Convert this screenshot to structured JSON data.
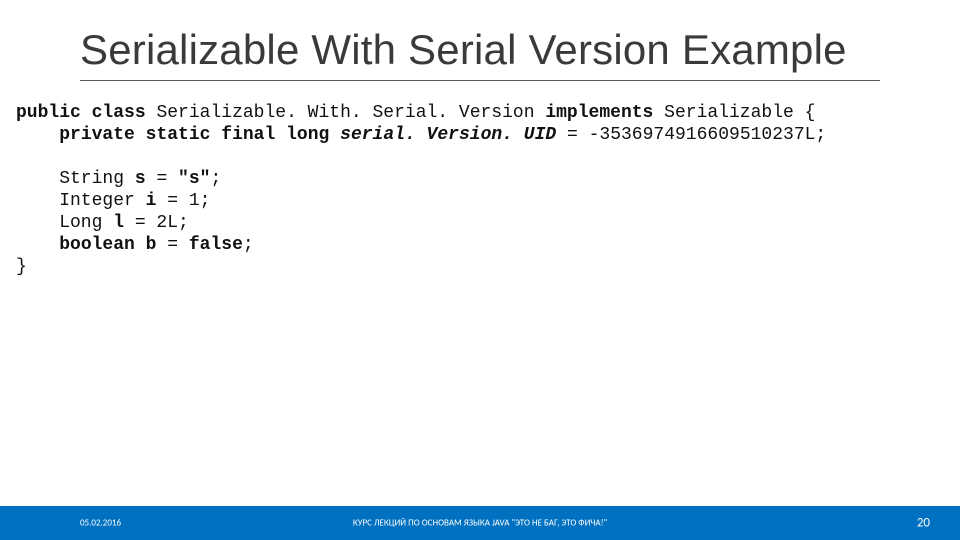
{
  "title": "Serializable With Serial Version Example",
  "code": {
    "kw_public": "public",
    "kw_class": "class",
    "className": "Serializable. With. Serial. Version",
    "kw_implements": "implements",
    "iface": "Serializable",
    "lbrace": " {",
    "indent1": "    ",
    "kw_private": "private",
    "kw_static": "static",
    "kw_final": "final",
    "kw_long_t": "long",
    "serialPre": "serial. Version. UID ",
    "eq": "= ",
    "serialVal": "-3536974916609510237L;",
    "blank": "",
    "sLine_pre": "    String ",
    "sLine_kw": "s",
    "sLine_eq": " = ",
    "sLine_val": "\"s\"",
    "semi": ";",
    "iLine_pre": "    Integer ",
    "iLine_kw": "i",
    "iLine_val": " = 1;",
    "lLine_pre": "    Long ",
    "lLine_kw": "l",
    "lLine_val": " = 2L;",
    "kw_boolean": "boolean",
    "bLine_kw": "b",
    "bLine_eq": " = ",
    "kw_false": "false",
    "rbrace": "}"
  },
  "footer": {
    "date": "05.02.2016",
    "course": "КУРС ЛЕКЦИЙ ПО ОСНОВАМ ЯЗЫКА JAVA \"ЭТО НЕ БАГ, ЭТО ФИЧА!\"",
    "page": "20"
  }
}
